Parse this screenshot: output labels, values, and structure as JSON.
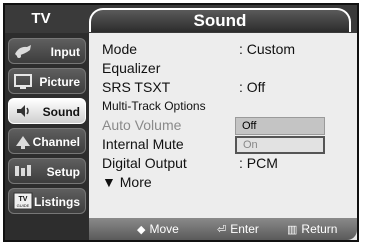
{
  "header": {
    "tv_label": "TV",
    "title": "Sound"
  },
  "sidebar": {
    "items": [
      {
        "label": "Input",
        "icon": "input-icon",
        "active": false
      },
      {
        "label": "Picture",
        "icon": "picture-icon",
        "active": false
      },
      {
        "label": "Sound",
        "icon": "sound-icon",
        "active": true
      },
      {
        "label": "Channel",
        "icon": "channel-icon",
        "active": false
      },
      {
        "label": "Setup",
        "icon": "setup-icon",
        "active": false
      },
      {
        "label": "Listings",
        "icon": "guide-icon",
        "active": false,
        "icon_text": "TV GUIDE"
      }
    ]
  },
  "menu": {
    "mode": {
      "label": "Mode",
      "value": ": Custom"
    },
    "equalizer": {
      "label": "Equalizer"
    },
    "srs": {
      "label": "SRS TSXT",
      "value": ": Off"
    },
    "multitrack": {
      "label": "Multi-Track Options"
    },
    "auto_volume": {
      "label": "Auto Volume",
      "options": [
        "Off",
        "On"
      ],
      "selected": "Off"
    },
    "internal_mute": {
      "label": "Internal Mute"
    },
    "digital_output": {
      "label": "Digital Output",
      "value": ": PCM"
    },
    "more": {
      "label": "▼ More"
    }
  },
  "footer": {
    "move": "Move",
    "enter": "Enter",
    "return": "Return"
  }
}
